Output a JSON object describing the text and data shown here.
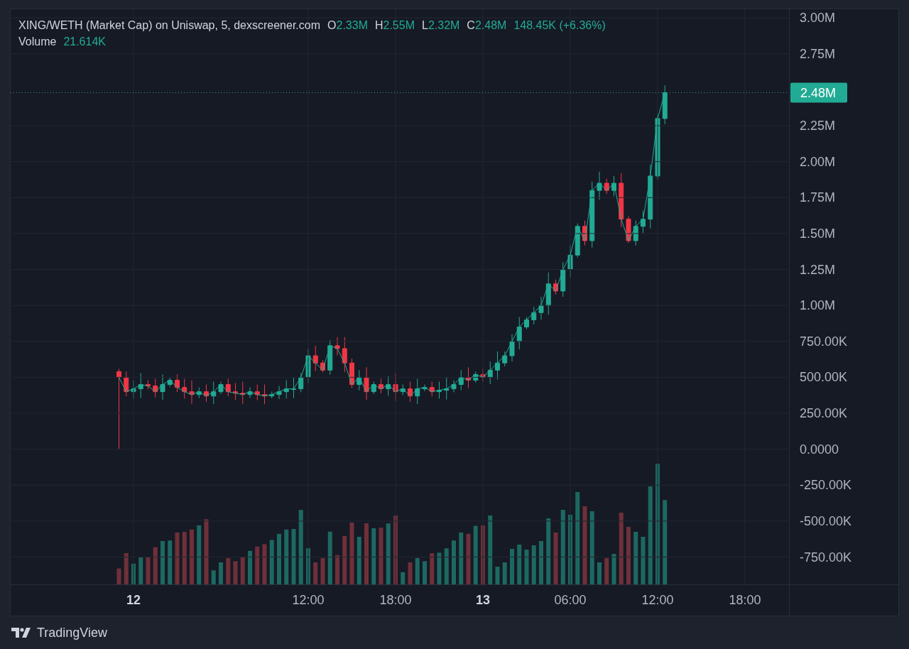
{
  "legend": {
    "title": "XING/WETH (Market Cap) on Uniswap, 5, dexscreener.com",
    "ohlc": [
      {
        "label": "O",
        "value": "2.33M"
      },
      {
        "label": "H",
        "value": "2.55M"
      },
      {
        "label": "L",
        "value": "2.32M"
      },
      {
        "label": "C",
        "value": "2.48M"
      }
    ],
    "change": "148.45K (+6.36%)",
    "volume_label": "Volume",
    "volume_value": "21.614K"
  },
  "time_axis": [
    {
      "label": "12",
      "major": true
    },
    {
      "label": "12:00",
      "major": false
    },
    {
      "label": "18:00",
      "major": false
    },
    {
      "label": "13",
      "major": true
    },
    {
      "label": "06:00",
      "major": false
    },
    {
      "label": "12:00",
      "major": false
    },
    {
      "label": "18:00",
      "major": false
    }
  ],
  "chart": {
    "chart_data": {
      "type": "line",
      "grid": true,
      "ylim": [
        -940000,
        3060000
      ],
      "yticks": [
        {
          "value": 3000000,
          "label": "3.00M"
        },
        {
          "value": 2750000,
          "label": "2.75M"
        },
        {
          "value": 2250000,
          "label": "2.25M"
        },
        {
          "value": 2000000,
          "label": "2.00M"
        },
        {
          "value": 1750000,
          "label": "1.75M"
        },
        {
          "value": 1500000,
          "label": "1.50M"
        },
        {
          "value": 1250000,
          "label": "1.25M"
        },
        {
          "value": 1000000,
          "label": "1.00M"
        },
        {
          "value": 750000,
          "label": "750.00K"
        },
        {
          "value": 500000,
          "label": "500.00K"
        },
        {
          "value": 250000,
          "label": "250.00K"
        },
        {
          "value": 0,
          "label": "0.0000"
        },
        {
          "value": -250000,
          "label": "-250.00K"
        },
        {
          "value": -500000,
          "label": "-500.00K"
        },
        {
          "value": -750000,
          "label": "-750.00K"
        }
      ],
      "ref_lines": [
        {
          "axis": "y",
          "value": 2480000,
          "label": "2.48M"
        }
      ],
      "categories": [
        null,
        null,
        null,
        null,
        null,
        null,
        null,
        null,
        null,
        null,
        null,
        null,
        null,
        null,
        null,
        null,
        null,
        null,
        null,
        null,
        null,
        null,
        null,
        null,
        null,
        null,
        null,
        null,
        null,
        null,
        null,
        null,
        null,
        null,
        null,
        null,
        null,
        null,
        null,
        null,
        null,
        null,
        null,
        null,
        null,
        null,
        null,
        null,
        null,
        null,
        null,
        null,
        null,
        null,
        null,
        null,
        null,
        null,
        null,
        null,
        null,
        null,
        null,
        null,
        null,
        null,
        null,
        null,
        null,
        null,
        null,
        null,
        null,
        null,
        null,
        null
      ],
      "series": [
        {
          "color": "#22ab94",
          "values": [
            500000,
            400000,
            420000,
            450000,
            440000,
            400000,
            450000,
            480000,
            430000,
            400000,
            380000,
            400000,
            370000,
            400000,
            450000,
            400000,
            390000,
            380000,
            400000,
            380000,
            370000,
            380000,
            400000,
            420000,
            420000,
            500000,
            650000,
            600000,
            550000,
            720000,
            700000,
            600000,
            450000,
            500000,
            400000,
            450000,
            420000,
            450000,
            400000,
            420000,
            370000,
            420000,
            430000,
            400000,
            410000,
            420000,
            450000,
            500000,
            480000,
            520000,
            500000,
            550000,
            600000,
            650000,
            750000,
            850000,
            900000,
            950000,
            1000000,
            1150000,
            1100000,
            1250000,
            1350000,
            1550000,
            1450000,
            1800000,
            1850000,
            1800000,
            1850000,
            1600000,
            1450000,
            1550000,
            1600000,
            1900000,
            2300000,
            2480000
          ]
        }
      ]
    }
  },
  "footer": {
    "brand": "TradingView"
  }
}
